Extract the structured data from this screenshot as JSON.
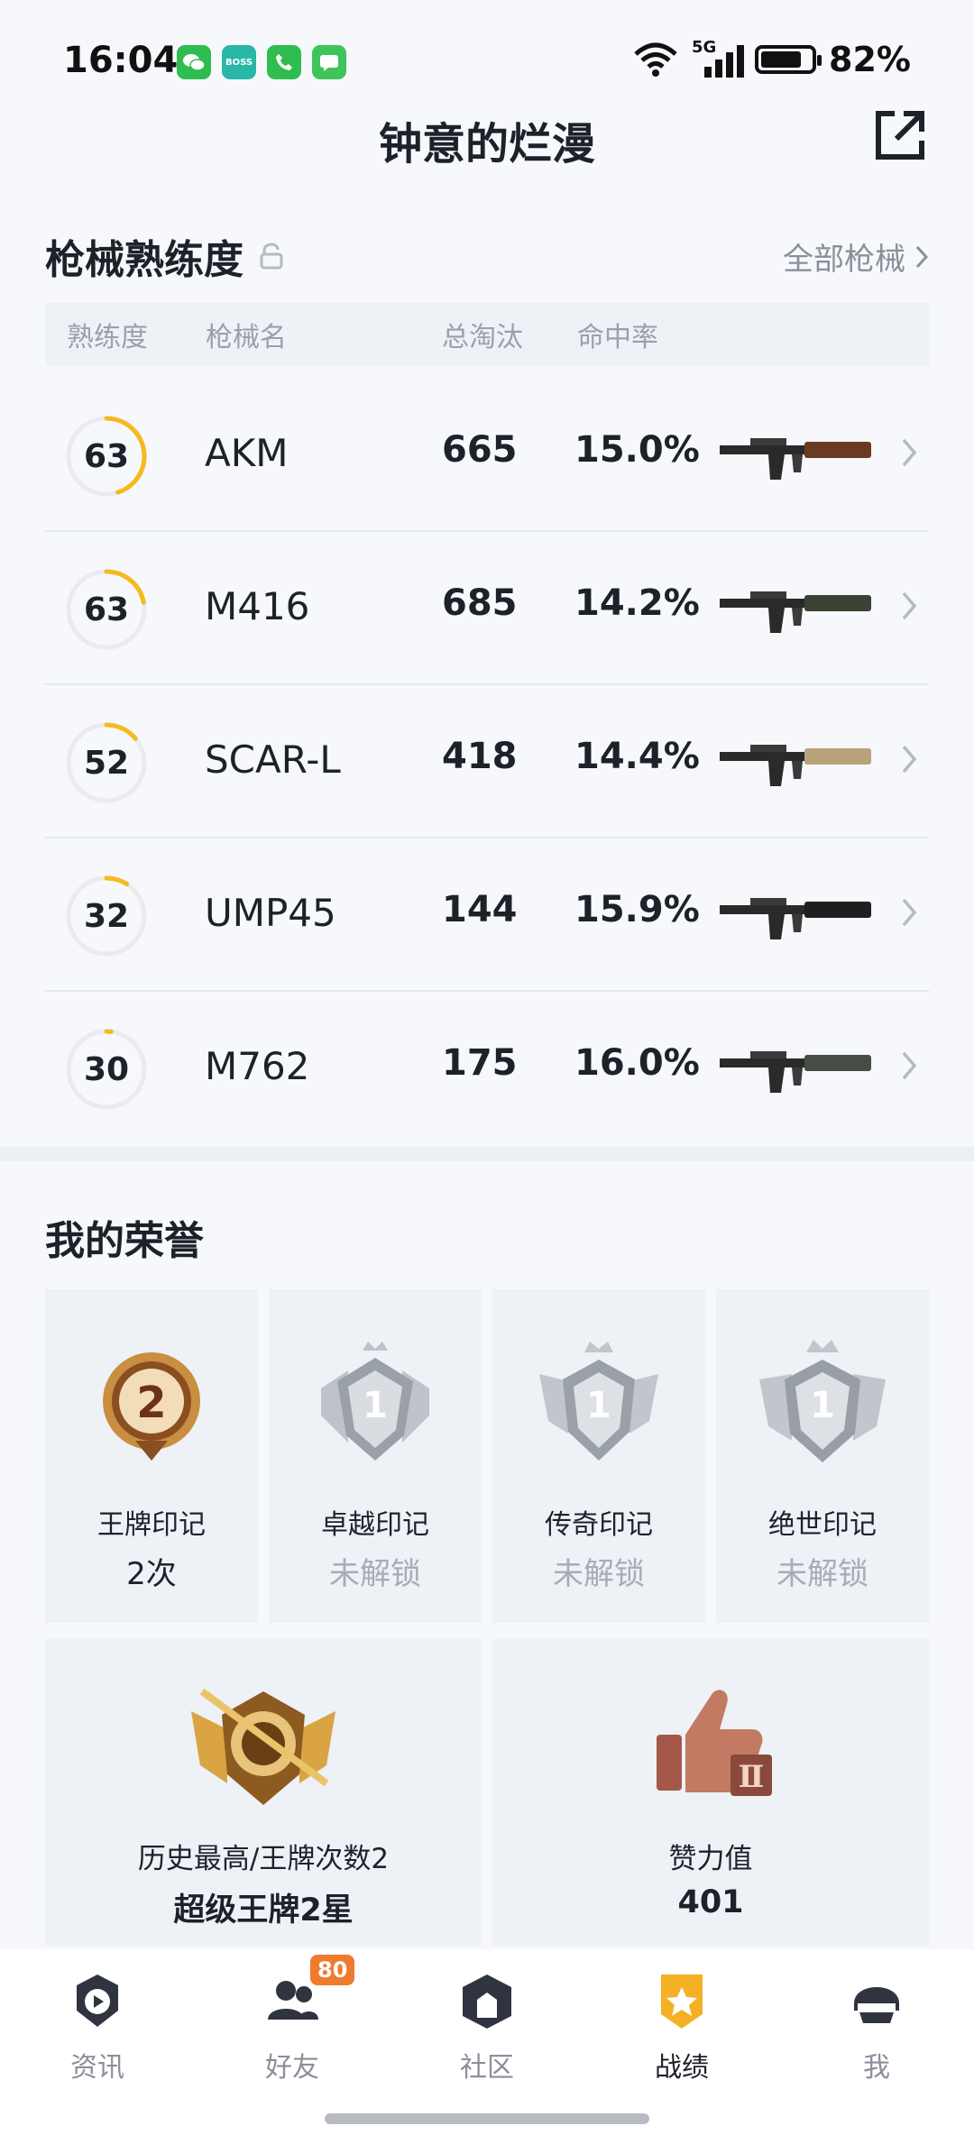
{
  "status": {
    "time": "16:04",
    "network": "5G",
    "battery_percent": "82%",
    "battery_level": 0.82,
    "app_badges": [
      {
        "name": "wechat-icon",
        "color": "#2fbd4f",
        "text": ""
      },
      {
        "name": "boss-icon",
        "color": "#29b7a8",
        "text": "BOSS"
      },
      {
        "name": "phone-icon",
        "color": "#2fbd4f",
        "text": ""
      },
      {
        "name": "message-icon",
        "color": "#3fc45a",
        "text": ""
      }
    ]
  },
  "header": {
    "title": "钟意的烂漫",
    "share_icon": "share-icon"
  },
  "weapons_section": {
    "title": "枪械熟练度",
    "all_link": "全部枪械",
    "columns": {
      "proficiency": "熟练度",
      "name": "枪械名",
      "kills": "总淘汰",
      "accuracy": "命中率"
    },
    "rows": [
      {
        "level": "63",
        "progress": 0.45,
        "name": "AKM",
        "kills": "665",
        "accuracy": "15.0%",
        "gun_color": "#6b3a22"
      },
      {
        "level": "63",
        "progress": 0.22,
        "name": "M416",
        "kills": "685",
        "accuracy": "14.2%",
        "gun_color": "#3c4233"
      },
      {
        "level": "52",
        "progress": 0.14,
        "name": "SCAR-L",
        "kills": "418",
        "accuracy": "14.4%",
        "gun_color": "#b8a37a"
      },
      {
        "level": "32",
        "progress": 0.09,
        "name": "UMP45",
        "kills": "144",
        "accuracy": "15.9%",
        "gun_color": "#1f1f1f"
      },
      {
        "level": "30",
        "progress": 0.02,
        "name": "M762",
        "kills": "175",
        "accuracy": "16.0%",
        "gun_color": "#474d44"
      }
    ]
  },
  "honors": {
    "title": "我的荣誉",
    "cards": [
      {
        "name": "王牌印记",
        "value": "2次",
        "number": "2",
        "locked": false
      },
      {
        "name": "卓越印记",
        "value": "未解锁",
        "number": "1",
        "locked": true
      },
      {
        "name": "传奇印记",
        "value": "未解锁",
        "number": "1",
        "locked": true
      },
      {
        "name": "绝世印记",
        "value": "未解锁",
        "number": "1",
        "locked": true
      }
    ],
    "highest": {
      "label": "历史最高/王牌次数2",
      "value": "超级王牌2星"
    },
    "likes": {
      "label": "赞力值",
      "value": "401"
    }
  },
  "tabbar": {
    "tabs": [
      {
        "label": "资讯",
        "icon": "news-icon"
      },
      {
        "label": "好友",
        "icon": "friends-icon",
        "badge": "80"
      },
      {
        "label": "社区",
        "icon": "community-icon"
      },
      {
        "label": "战绩",
        "icon": "record-icon",
        "active": true
      },
      {
        "label": "我",
        "icon": "profile-icon"
      }
    ]
  }
}
